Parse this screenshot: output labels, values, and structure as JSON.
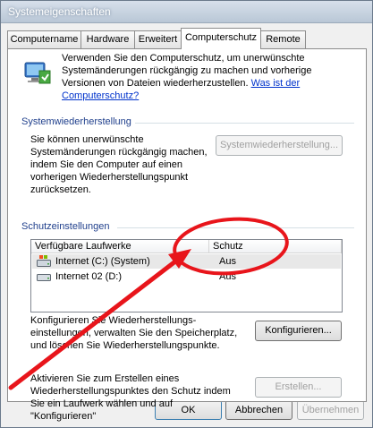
{
  "window": {
    "title": "Systemeigenschaften"
  },
  "tabs": [
    {
      "label": "Computername",
      "active": false
    },
    {
      "label": "Hardware",
      "active": false
    },
    {
      "label": "Erweitert",
      "active": false
    },
    {
      "label": "Computerschutz",
      "active": true
    },
    {
      "label": "Remote",
      "active": false
    }
  ],
  "intro": {
    "text": "Verwenden Sie den Computerschutz, um unerwünschte Systemänderungen rückgängig zu machen und vorherige Versionen von Dateien wiederherzustellen.",
    "link": "Was ist der Computerschutz?",
    "icon": "system-protection-icon"
  },
  "restore": {
    "heading": "Systemwiederherstellung",
    "text": "Sie können unerwünschte Systemänderungen rückgängig machen, indem Sie den Computer auf einen vorherigen Wiederherstellungspunkt zurücksetzen.",
    "button": "Systemwiederherstellung..."
  },
  "protection": {
    "heading": "Schutzeinstellungen",
    "columns": [
      "Verfügbare Laufwerke",
      "Schutz"
    ],
    "drives": [
      {
        "name": "Internet (C:) (System)",
        "status": "Aus",
        "icon": "system-drive-icon"
      },
      {
        "name": "Internet 02 (D:)",
        "status": "Aus",
        "icon": "drive-icon"
      }
    ],
    "configure_text": "Konfigurieren Sie Wiederherstellungs-einstellungen, verwalten Sie den Speicherplatz, und löschen Sie Wiederherstellungspunkte.",
    "configure_button": "Konfigurieren...",
    "create_text": "Aktivieren Sie zum Erstellen eines Wiederherstellungspunktes den Schutz indem Sie ein Laufwerk wählen und auf \"Konfigurieren\"",
    "create_button": "Erstellen..."
  },
  "footer": {
    "ok": "OK",
    "cancel": "Abbrechen",
    "apply": "Übernehmen"
  },
  "annotation_color": "#e8151b"
}
